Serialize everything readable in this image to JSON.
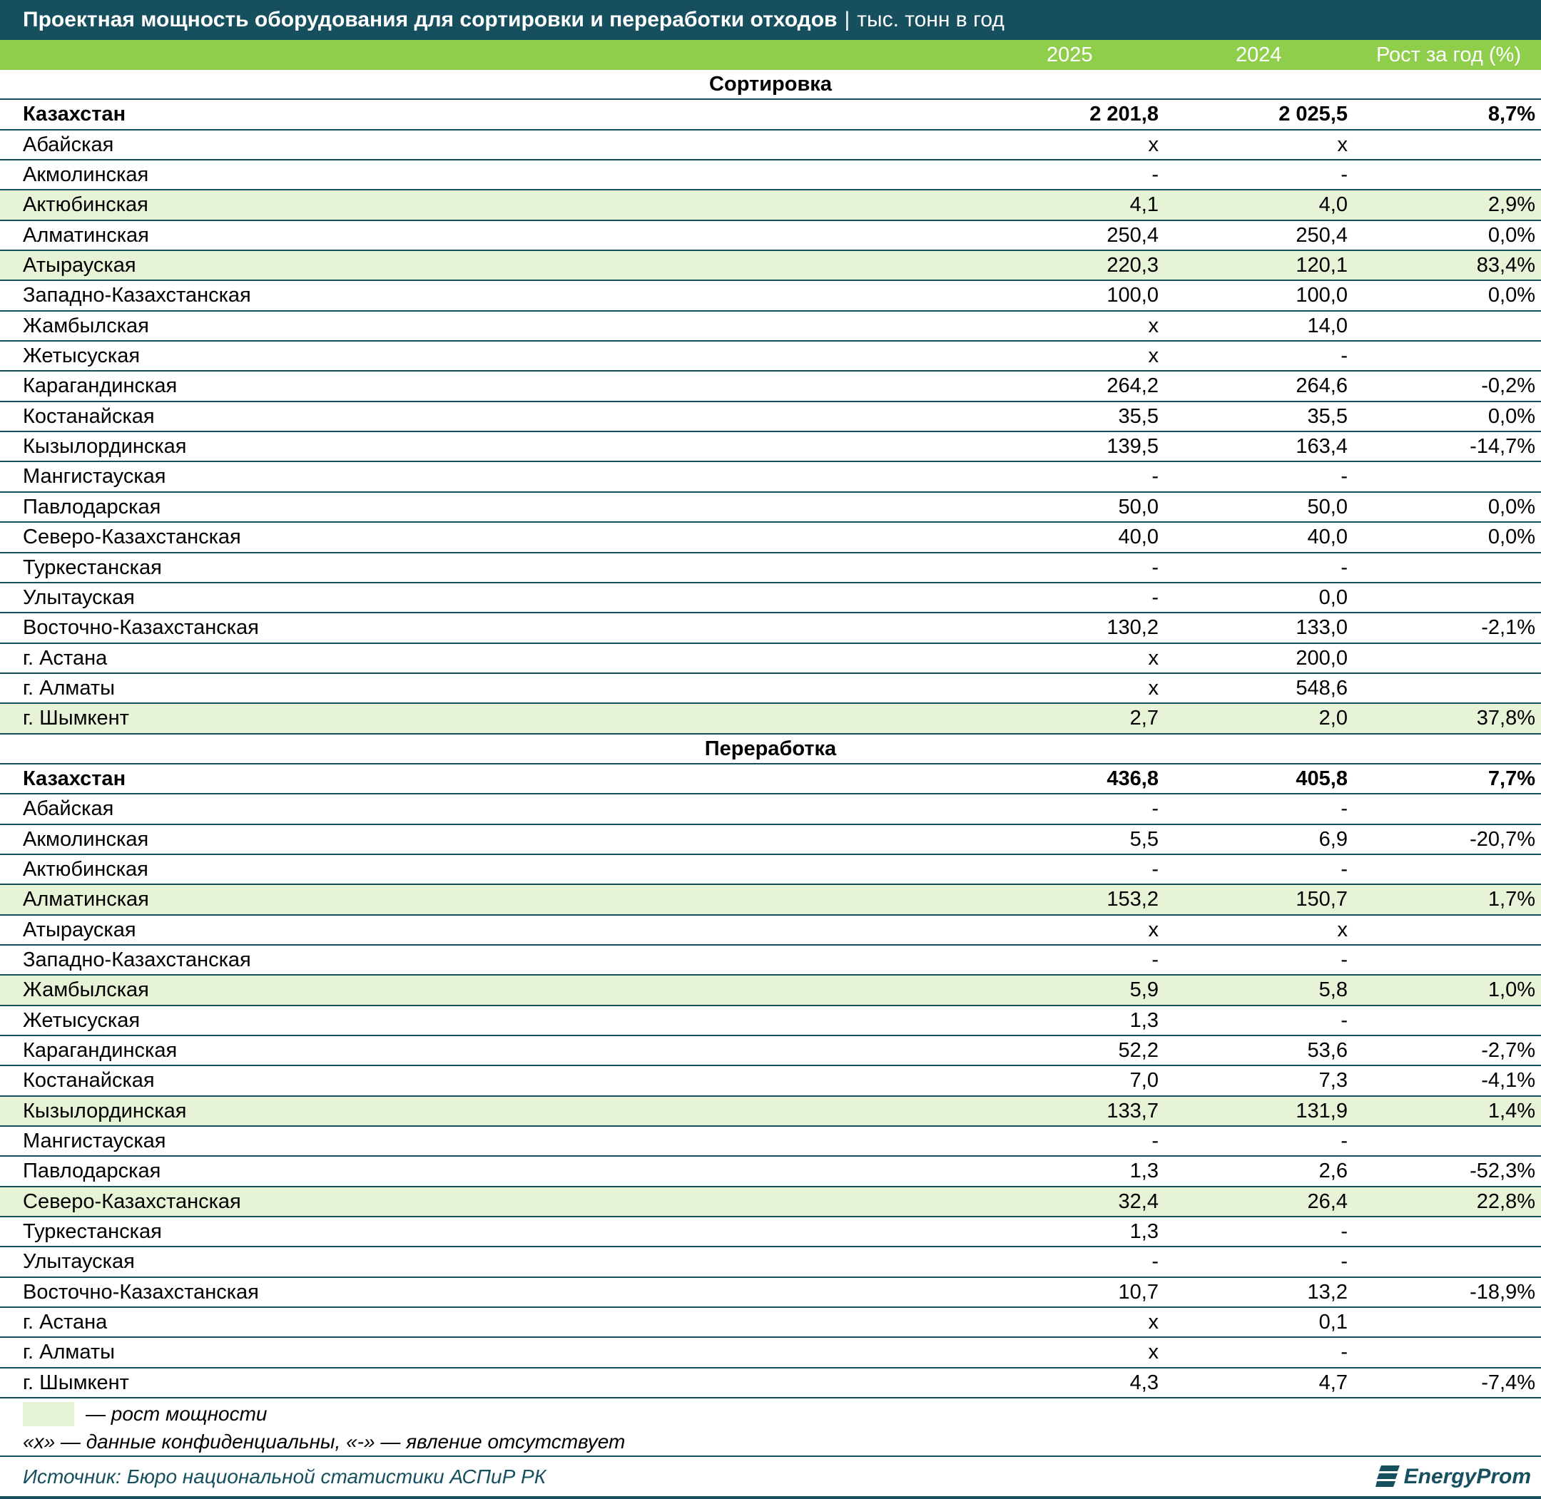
{
  "header": {
    "title": "Проектная мощность оборудования для сортировки и переработки отходов",
    "separator": "|",
    "unit": "тыс. тонн в год"
  },
  "columns": {
    "c2025": "2025",
    "c2024": "2024",
    "growth": "Рост за год (%)"
  },
  "colors": {
    "header_bg": "#16505f",
    "column_header_bg": "#8fce4a",
    "highlight_row": "#e6f3d6"
  },
  "chart_data": {
    "type": "table",
    "sections": [
      {
        "name": "Сортировка",
        "rows": [
          {
            "region": "Казахстан",
            "v2025": "2 201,8",
            "v2024": "2 025,5",
            "growth": "8,7%",
            "total": true,
            "highlight": false
          },
          {
            "region": "Абайская",
            "v2025": "х",
            "v2024": "х",
            "growth": "",
            "highlight": false
          },
          {
            "region": "Акмолинская",
            "v2025": "-",
            "v2024": "-",
            "growth": "",
            "highlight": false
          },
          {
            "region": "Актюбинская",
            "v2025": "4,1",
            "v2024": "4,0",
            "growth": "2,9%",
            "highlight": true
          },
          {
            "region": "Алматинская",
            "v2025": "250,4",
            "v2024": "250,4",
            "growth": "0,0%",
            "highlight": false
          },
          {
            "region": "Атырауская",
            "v2025": "220,3",
            "v2024": "120,1",
            "growth": "83,4%",
            "highlight": true
          },
          {
            "region": "Западно-Казахстанская",
            "v2025": "100,0",
            "v2024": "100,0",
            "growth": "0,0%",
            "highlight": false
          },
          {
            "region": "Жамбылская",
            "v2025": "х",
            "v2024": "14,0",
            "growth": "",
            "highlight": false
          },
          {
            "region": "Жетысуская",
            "v2025": "х",
            "v2024": "-",
            "growth": "",
            "highlight": false
          },
          {
            "region": "Карагандинская",
            "v2025": "264,2",
            "v2024": "264,6",
            "growth": "-0,2%",
            "highlight": false
          },
          {
            "region": "Костанайская",
            "v2025": "35,5",
            "v2024": "35,5",
            "growth": "0,0%",
            "highlight": false
          },
          {
            "region": "Кызылординская",
            "v2025": "139,5",
            "v2024": "163,4",
            "growth": "-14,7%",
            "highlight": false
          },
          {
            "region": "Мангистауская",
            "v2025": "-",
            "v2024": "-",
            "growth": "",
            "highlight": false
          },
          {
            "region": "Павлодарская",
            "v2025": "50,0",
            "v2024": "50,0",
            "growth": "0,0%",
            "highlight": false
          },
          {
            "region": "Северо-Казахстанская",
            "v2025": "40,0",
            "v2024": "40,0",
            "growth": "0,0%",
            "highlight": false
          },
          {
            "region": "Туркестанская",
            "v2025": "-",
            "v2024": "-",
            "growth": "",
            "highlight": false
          },
          {
            "region": "Улытауская",
            "v2025": "-",
            "v2024": "0,0",
            "growth": "",
            "highlight": false
          },
          {
            "region": "Восточно-Казахстанская",
            "v2025": "130,2",
            "v2024": "133,0",
            "growth": "-2,1%",
            "highlight": false
          },
          {
            "region": "г. Астана",
            "v2025": "х",
            "v2024": "200,0",
            "growth": "",
            "highlight": false
          },
          {
            "region": "г. Алматы",
            "v2025": "х",
            "v2024": "548,6",
            "growth": "",
            "highlight": false
          },
          {
            "region": "г. Шымкент",
            "v2025": "2,7",
            "v2024": "2,0",
            "growth": "37,8%",
            "highlight": true
          }
        ]
      },
      {
        "name": "Переработка",
        "rows": [
          {
            "region": "Казахстан",
            "v2025": "436,8",
            "v2024": "405,8",
            "growth": "7,7%",
            "total": true,
            "highlight": false
          },
          {
            "region": "Абайская",
            "v2025": "-",
            "v2024": "-",
            "growth": "",
            "highlight": false
          },
          {
            "region": "Акмолинская",
            "v2025": "5,5",
            "v2024": "6,9",
            "growth": "-20,7%",
            "highlight": false
          },
          {
            "region": "Актюбинская",
            "v2025": "-",
            "v2024": "-",
            "growth": "",
            "highlight": false
          },
          {
            "region": "Алматинская",
            "v2025": "153,2",
            "v2024": "150,7",
            "growth": "1,7%",
            "highlight": true
          },
          {
            "region": "Атырауская",
            "v2025": "х",
            "v2024": "х",
            "growth": "",
            "highlight": false
          },
          {
            "region": "Западно-Казахстанская",
            "v2025": "-",
            "v2024": "-",
            "growth": "",
            "highlight": false
          },
          {
            "region": "Жамбылская",
            "v2025": "5,9",
            "v2024": "5,8",
            "growth": "1,0%",
            "highlight": true
          },
          {
            "region": "Жетысуская",
            "v2025": "1,3",
            "v2024": "-",
            "growth": "",
            "highlight": false
          },
          {
            "region": "Карагандинская",
            "v2025": "52,2",
            "v2024": "53,6",
            "growth": "-2,7%",
            "highlight": false
          },
          {
            "region": "Костанайская",
            "v2025": "7,0",
            "v2024": "7,3",
            "growth": "-4,1%",
            "highlight": false
          },
          {
            "region": "Кызылординская",
            "v2025": "133,7",
            "v2024": "131,9",
            "growth": "1,4%",
            "highlight": true
          },
          {
            "region": "Мангистауская",
            "v2025": "-",
            "v2024": "-",
            "growth": "",
            "highlight": false
          },
          {
            "region": "Павлодарская",
            "v2025": "1,3",
            "v2024": "2,6",
            "growth": "-52,3%",
            "highlight": false
          },
          {
            "region": "Северо-Казахстанская",
            "v2025": "32,4",
            "v2024": "26,4",
            "growth": "22,8%",
            "highlight": true
          },
          {
            "region": "Туркестанская",
            "v2025": "1,3",
            "v2024": "-",
            "growth": "",
            "highlight": false
          },
          {
            "region": "Улытауская",
            "v2025": "-",
            "v2024": "-",
            "growth": "",
            "highlight": false
          },
          {
            "region": "Восточно-Казахстанская",
            "v2025": "10,7",
            "v2024": "13,2",
            "growth": "-18,9%",
            "highlight": false
          },
          {
            "region": "г. Астана",
            "v2025": "х",
            "v2024": "0,1",
            "growth": "",
            "highlight": false
          },
          {
            "region": "г. Алматы",
            "v2025": "х",
            "v2024": "-",
            "growth": "",
            "highlight": false
          },
          {
            "region": "г. Шымкент",
            "v2025": "4,3",
            "v2024": "4,7",
            "growth": "-7,4%",
            "highlight": false
          }
        ]
      }
    ]
  },
  "legend": {
    "growth_label": "— рост мощности",
    "notes": "«х» — данные конфиденциальны, «-» — явление отсутствует"
  },
  "footer": {
    "source": "Источник: Бюро национальной статистики АСПиР РК",
    "logo_text": "EnergyProm",
    "logo_icon": "energyprom-logo-icon"
  }
}
